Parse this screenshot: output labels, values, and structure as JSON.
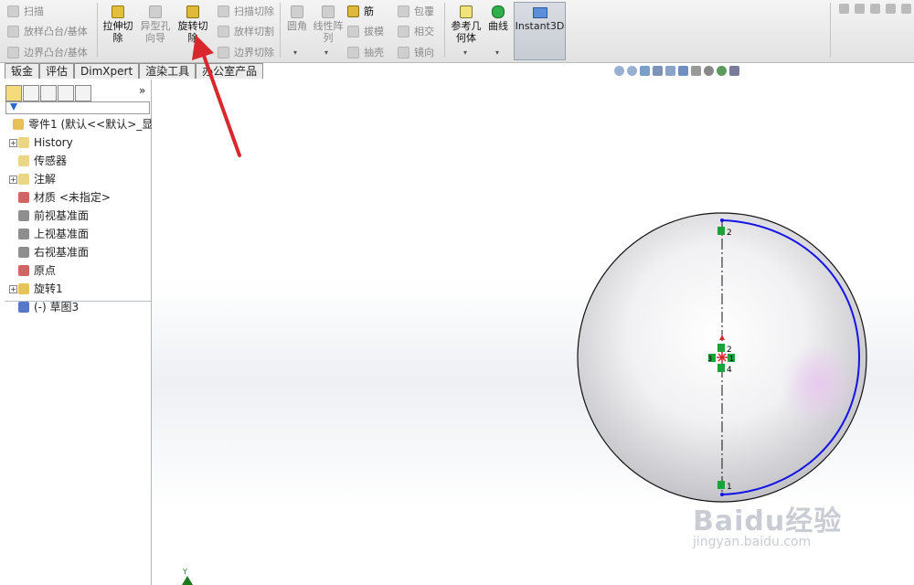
{
  "ribbon": {
    "col1": [
      "扫描",
      "放样凸台/基体",
      "边界凸台/基体"
    ],
    "extrude_cut": [
      "拉伸切",
      "除"
    ],
    "hole_wizard": [
      "异型孔",
      "向导"
    ],
    "revolve_cut": [
      "旋转切",
      "除"
    ],
    "col4": [
      "扫描切除",
      "放样切割",
      "边界切除"
    ],
    "fillet": "圆角",
    "linear_pattern": [
      "线性阵",
      "列"
    ],
    "col6": [
      "筋",
      "拔模",
      "抽壳"
    ],
    "col7": [
      "包覆",
      "相交",
      "镜向"
    ],
    "ref_geometry": [
      "参考几",
      "何体"
    ],
    "curves": "曲线",
    "instant3d": "Instant3D"
  },
  "tabs": [
    "钣金",
    "评估",
    "DimXpert",
    "渲染工具",
    "办公室产品"
  ],
  "panel": {
    "more": "»",
    "tree": [
      {
        "label": "零件1 (默认<<默认>_显示",
        "exp": ""
      },
      {
        "label": "History",
        "exp": "+"
      },
      {
        "label": "传感器",
        "exp": ""
      },
      {
        "label": "注解",
        "exp": "+"
      },
      {
        "label": "材质 <未指定>",
        "exp": ""
      },
      {
        "label": "前视基准面",
        "exp": ""
      },
      {
        "label": "上视基准面",
        "exp": ""
      },
      {
        "label": "右视基准面",
        "exp": ""
      },
      {
        "label": "原点",
        "exp": ""
      },
      {
        "label": "旋转1",
        "exp": "+"
      },
      {
        "label": "(-) 草图3",
        "exp": ""
      }
    ]
  },
  "viewport": {
    "labels": {
      "top": "2",
      "mid_top": "2",
      "mid_left": "3",
      "mid_right": "1",
      "mid_bottom": "4",
      "bottom": "1",
      "axis_y": "Y"
    }
  },
  "watermark": {
    "line1": "Baidu经验",
    "line2": "jingyan.baidu.com"
  },
  "colors": {
    "accent": "#d9272e",
    "sketch_line": "#1414e6",
    "constraint": "#1aa33a",
    "sphere_edge": "#111111"
  }
}
